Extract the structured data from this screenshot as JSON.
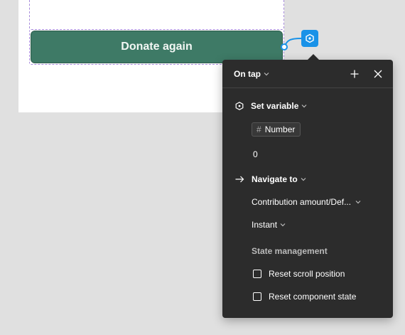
{
  "canvas": {
    "donate_button_label": "Donate again"
  },
  "interaction_panel": {
    "trigger_label": "On tap",
    "actions": [
      {
        "type_label": "Set variable",
        "variable_chip_label": "Number",
        "value": "0"
      },
      {
        "type_label": "Navigate to",
        "destination": "Contribution amount/Def...",
        "animation": "Instant"
      }
    ],
    "state_management": {
      "heading": "State management",
      "reset_scroll_label": "Reset scroll position",
      "reset_scroll_checked": false,
      "reset_component_label": "Reset component state",
      "reset_component_checked": false
    }
  },
  "colors": {
    "button_fill": "#3e7a66",
    "accent_blue": "#1992e8",
    "panel_bg": "#2c2c2c",
    "canvas_bg": "#e0e0e0"
  },
  "icons": [
    "variable-icon",
    "arrow-right-icon",
    "plus-icon",
    "close-icon",
    "hash-icon",
    "chevron-down-icon",
    "interaction-icon"
  ]
}
